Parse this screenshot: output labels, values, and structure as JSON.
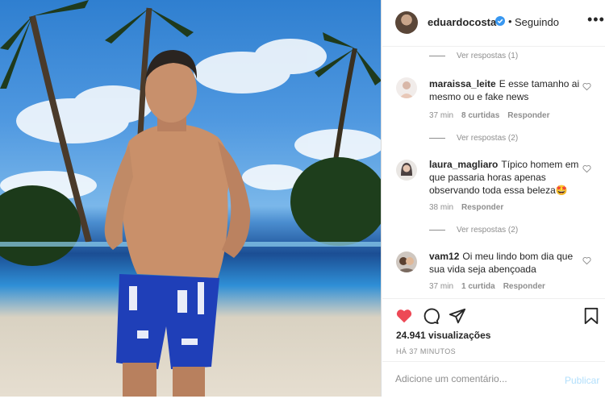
{
  "post": {
    "username": "eduardocosta",
    "separator": "•",
    "follow_label": "Seguindo",
    "more_label": "•••"
  },
  "comments": [
    {
      "type": "replies",
      "label": "Ver respostas (1)"
    },
    {
      "type": "comment",
      "username": "maraissa_leite",
      "text": "E esse tamanho ai mesmo ou e fake news",
      "time": "37 min",
      "likes": "8 curtidas",
      "reply": "Responder"
    },
    {
      "type": "replies",
      "label": "Ver respostas (2)"
    },
    {
      "type": "comment",
      "username": "laura_magliaro",
      "text": "Típico homem em que passaria horas apenas observando toda essa beleza",
      "emoji": "🤩",
      "time": "38 min",
      "reply": "Responder"
    },
    {
      "type": "replies",
      "label": "Ver respostas (2)"
    },
    {
      "type": "comment",
      "username": "vam12",
      "text": "Oi meu lindo bom dia que sua vida seja abençoada",
      "time": "37 min",
      "likes": "1 curtida",
      "reply": "Responder"
    }
  ],
  "actions": {
    "views": "24.941 visualizações",
    "time_ago": "HÁ 37 MINUTOS",
    "like_icon": "heart-filled-icon",
    "like_color": "#ed4956"
  },
  "add_comment": {
    "placeholder": "Adicione um comentário...",
    "publish_label": "Publicar",
    "publish_color": "#b2dffc"
  }
}
